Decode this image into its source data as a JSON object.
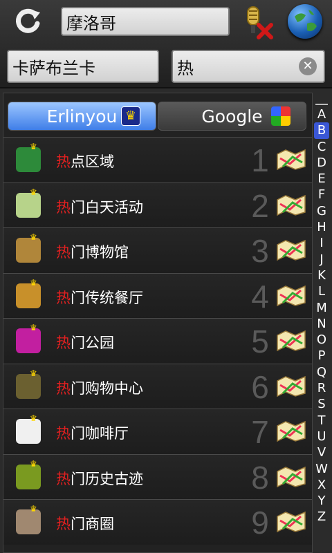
{
  "header": {
    "city_value": "摩洛哥",
    "location_value": "卡萨布兰卡",
    "keyword_value": "热",
    "clear_label": "✕"
  },
  "tabs": [
    {
      "label": "Erlinyou",
      "active": true
    },
    {
      "label": "Google",
      "active": false
    }
  ],
  "results": [
    {
      "highlight": "热",
      "rest": "点区域",
      "num": "1",
      "icon": "hotspot-area-icon",
      "color": "#2d8a3a"
    },
    {
      "highlight": "热",
      "rest": "门白天活动",
      "num": "2",
      "icon": "daytime-activity-icon",
      "color": "#b7d38a"
    },
    {
      "highlight": "热",
      "rest": "门博物馆",
      "num": "3",
      "icon": "museum-icon",
      "color": "#b0863a"
    },
    {
      "highlight": "热",
      "rest": "门传统餐厅",
      "num": "4",
      "icon": "restaurant-icon",
      "color": "#c8902a"
    },
    {
      "highlight": "热",
      "rest": "门公园",
      "num": "5",
      "icon": "park-icon",
      "color": "#c21fa0"
    },
    {
      "highlight": "热",
      "rest": "门购物中心",
      "num": "6",
      "icon": "shopping-center-icon",
      "color": "#6b6030"
    },
    {
      "highlight": "热",
      "rest": "门咖啡厅",
      "num": "7",
      "icon": "cafe-icon",
      "color": "#f0f0f0"
    },
    {
      "highlight": "热",
      "rest": "门历史古迹",
      "num": "8",
      "icon": "historic-site-icon",
      "color": "#7a9a20"
    },
    {
      "highlight": "热",
      "rest": "门商圈",
      "num": "9",
      "icon": "business-district-icon",
      "color": "#a08870"
    }
  ],
  "alphabet": [
    "A",
    "B",
    "C",
    "D",
    "E",
    "F",
    "G",
    "H",
    "I",
    "J",
    "K",
    "L",
    "M",
    "N",
    "O",
    "P",
    "Q",
    "R",
    "S",
    "T",
    "U",
    "V",
    "W",
    "X",
    "Y",
    "Z"
  ],
  "alphabet_selected": "B"
}
